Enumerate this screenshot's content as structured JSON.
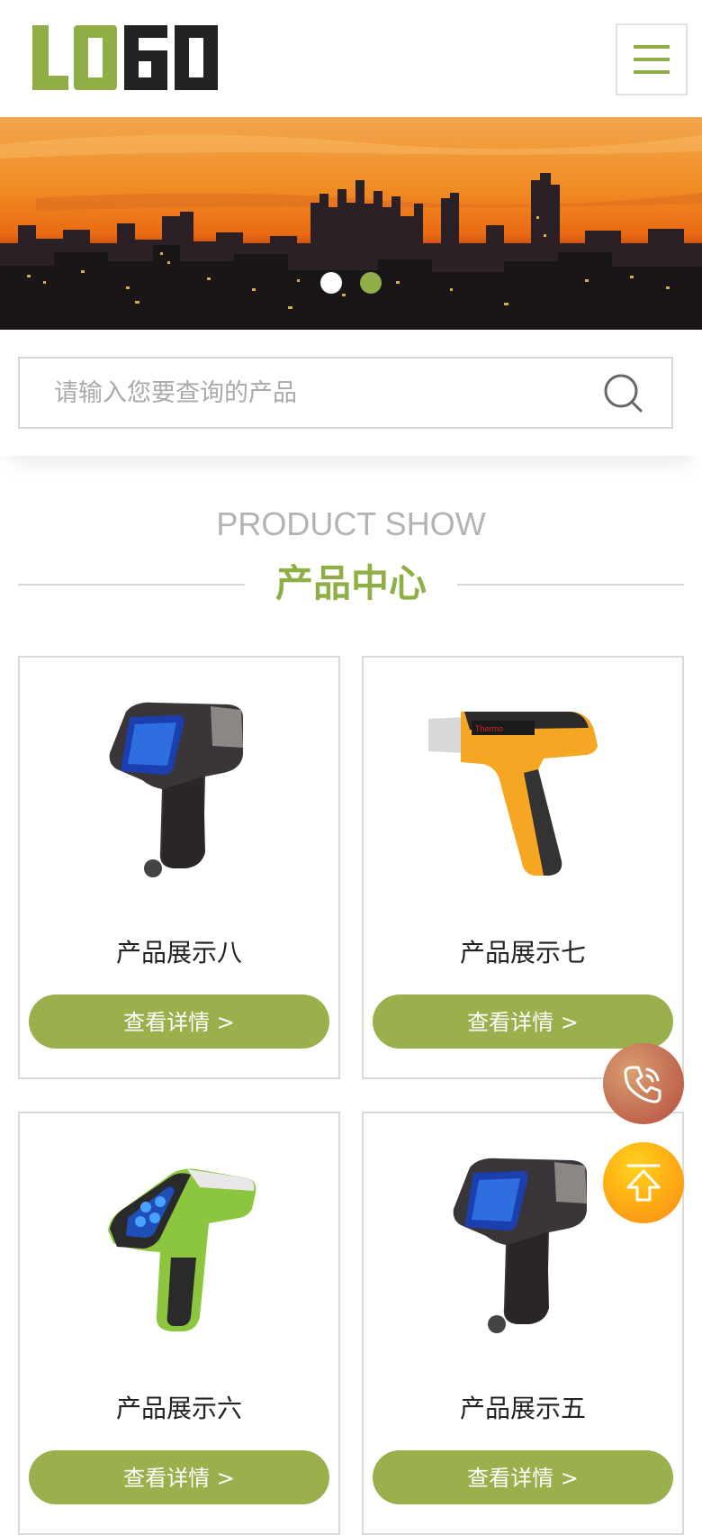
{
  "header": {
    "logo_text": "LOGO",
    "menu_icon": "hamburger-icon",
    "colors": {
      "accent": "#8fae45",
      "logo_dark": "#222222"
    }
  },
  "banner": {
    "slides_total": 2,
    "active_slide": 1
  },
  "search": {
    "placeholder": "请输入您要查询的产品",
    "icon": "search-icon"
  },
  "section": {
    "title_en": "PRODUCT SHOW",
    "title_cn": "产品中心"
  },
  "products": [
    {
      "name": "产品展示八",
      "button": "查看详情 >",
      "image": "dark-analyzer-device"
    },
    {
      "name": "产品展示七",
      "button": "查看详情 >",
      "image": "orange-analyzer-device"
    },
    {
      "name": "产品展示六",
      "button": "查看详情 >",
      "image": "green-analyzer-device"
    },
    {
      "name": "产品展示五",
      "button": "查看详情 >",
      "image": "dark-analyzer-device"
    }
  ],
  "floating": {
    "phone_icon": "phone-icon",
    "top_icon": "arrow-up-icon"
  }
}
